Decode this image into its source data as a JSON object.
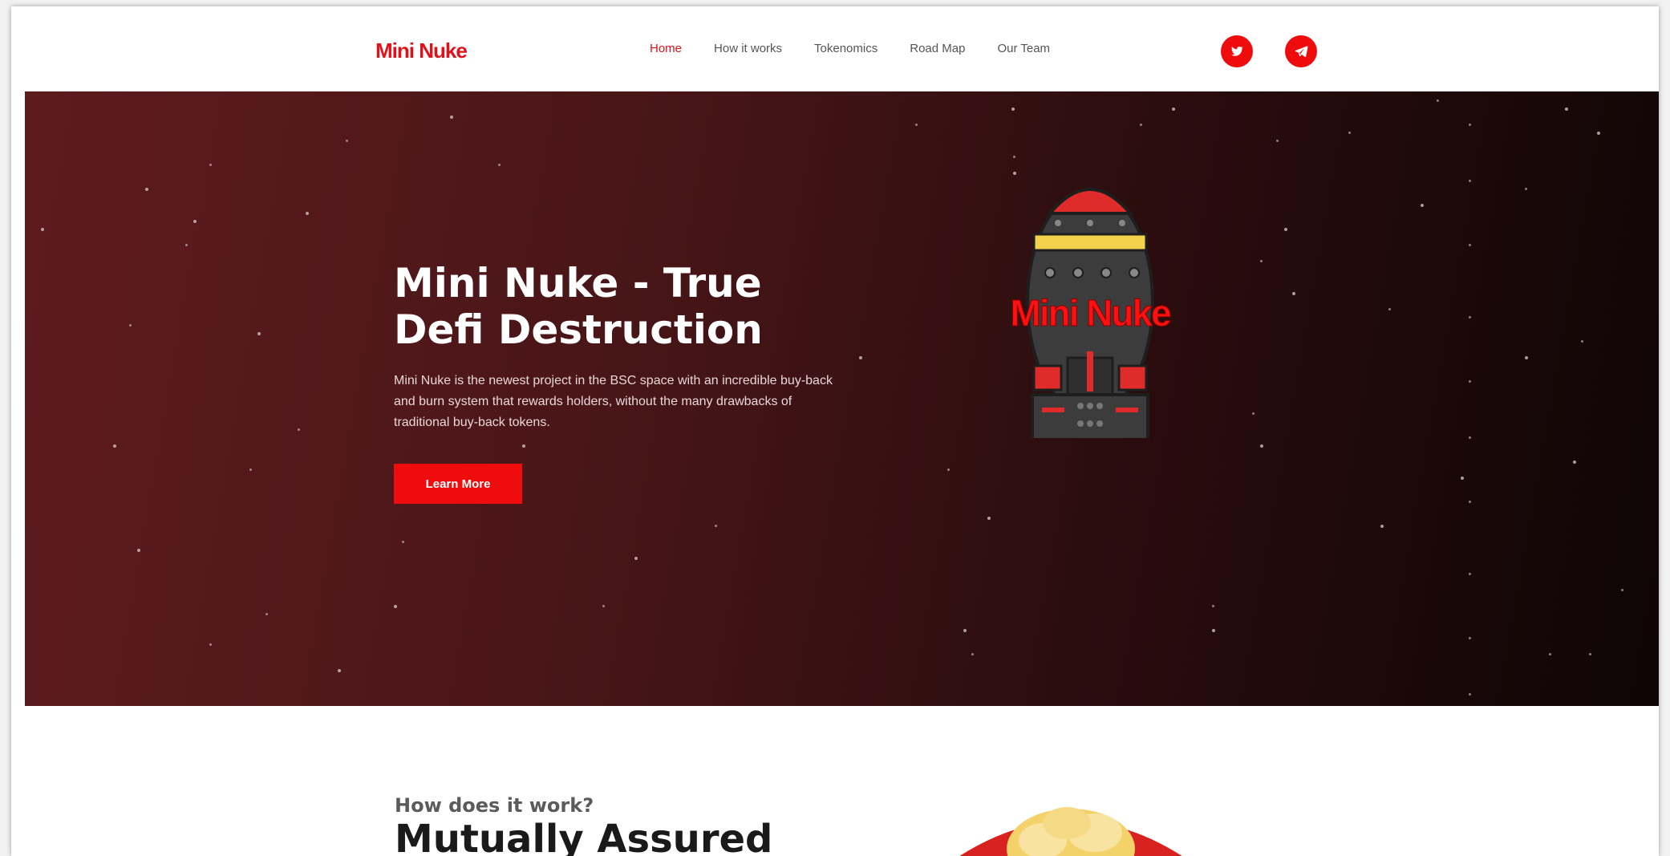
{
  "brand": {
    "logo_text": "Mini Nuke",
    "accent": "#ef0c0c"
  },
  "nav": {
    "items": [
      {
        "label": "Home",
        "active": true
      },
      {
        "label": "How it works",
        "active": false
      },
      {
        "label": "Tokenomics",
        "active": false
      },
      {
        "label": "Road Map",
        "active": false
      },
      {
        "label": "Our Team",
        "active": false
      }
    ],
    "social": [
      "twitter-icon",
      "telegram-icon"
    ]
  },
  "hero": {
    "title": "Mini Nuke - True Defi Destruction",
    "description": "Mini Nuke is the newest project in the BSC space with an incredible buy-back and burn system that rewards holders, without the many drawbacks of traditional buy-back tokens.",
    "button_label": "Learn More",
    "image_label": "Mini Nuke"
  },
  "section2": {
    "subtitle": "How does it work?",
    "heading": "Mutually Assured"
  }
}
